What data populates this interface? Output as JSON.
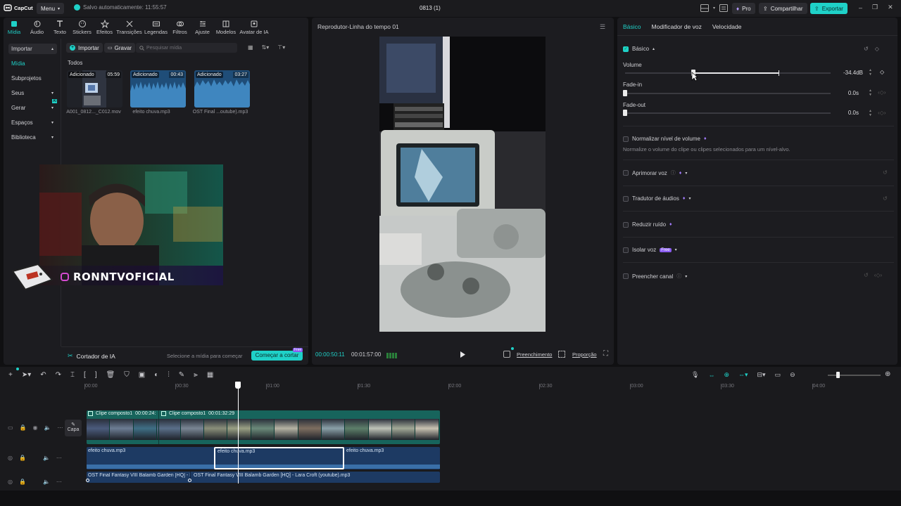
{
  "app": {
    "logo": "CapCut",
    "menu": "Menu",
    "autosave": "Salvo automaticamente: 11:55:57",
    "project_title": "0813 (1)",
    "pro": "Pro",
    "share": "Compartilhar",
    "export": "Exportar"
  },
  "toolbar_tabs": [
    {
      "label": "Mídia",
      "icon": "media-icon"
    },
    {
      "label": "Áudio",
      "icon": "audio-icon"
    },
    {
      "label": "Texto",
      "icon": "text-icon"
    },
    {
      "label": "Stickers",
      "icon": "sticker-icon"
    },
    {
      "label": "Efeitos",
      "icon": "effects-icon"
    },
    {
      "label": "Transições",
      "icon": "transitions-icon"
    },
    {
      "label": "Legendas",
      "icon": "captions-icon"
    },
    {
      "label": "Filtros",
      "icon": "filters-icon"
    },
    {
      "label": "Ajuste",
      "icon": "adjust-icon"
    },
    {
      "label": "Modelos",
      "icon": "templates-icon"
    },
    {
      "label": "Avatar de IA",
      "icon": "ai-avatar-icon"
    }
  ],
  "sidebar": {
    "items": [
      {
        "label": "Importar"
      },
      {
        "label": "Mídia"
      },
      {
        "label": "Subprojetos"
      },
      {
        "label": "Seus"
      },
      {
        "label": "Gerar"
      },
      {
        "label": "Espaços"
      },
      {
        "label": "Biblioteca"
      }
    ]
  },
  "media": {
    "import": "Importar",
    "record": "Gravar",
    "search_placeholder": "Pesquisar mídia",
    "section": "Todos",
    "items": [
      {
        "tag": "Adicionado",
        "duration": "05:59",
        "name": "A001_0812..._C012.mov"
      },
      {
        "tag": "Adicionado",
        "duration": "00:43",
        "name": "efeito chuva.mp3"
      },
      {
        "tag": "Adicionado",
        "duration": "03:27",
        "name": "OST Final ...outube).mp3"
      }
    ],
    "ai_cutter": "Cortador de IA",
    "ai_hint": "Selecione a mídia para começar",
    "start_cut": "Começar a cortar",
    "free_badge": "Free"
  },
  "overlay": {
    "channel": "RONNTVOFICIAL"
  },
  "player": {
    "title": "Reprodutor-Linha do tempo 01",
    "current_time": "00:00:50:11",
    "total_time": "00:01:57:00",
    "fill_label": "Preenchimento",
    "ratio_label": "Proporção"
  },
  "inspector": {
    "tabs": [
      "Básico",
      "Modificador de voz",
      "Velocidade"
    ],
    "section": "Básico",
    "volume_label": "Volume",
    "volume_value": "-34.4dB",
    "fadein_label": "Fade-in",
    "fadein_value": "0.0s",
    "fadeout_label": "Fade-out",
    "fadeout_value": "0.0s",
    "normalize_label": "Normalizar nível de volume",
    "normalize_desc": "Normalize o volume do clipe ou clipes selecionados para um nível-alvo.",
    "enhance_voice": "Aprimorar voz",
    "audio_translator": "Tradutor de áudios",
    "reduce_noise": "Reduzir ruído",
    "isolate_voice": "Isolar voz",
    "isolate_badge": "Free",
    "fill_channel": "Preencher canal"
  },
  "timeline": {
    "ruler": [
      "00:00",
      "00:30",
      "01:00",
      "01:30",
      "02:00",
      "02:30",
      "03:00",
      "03:30",
      "04:00"
    ],
    "cover_label": "Capa",
    "clip1": "Clipe composto1",
    "clip1_time": "00:00:24:",
    "clip2": "Clipe composto1",
    "clip2_time": "00:01:32:29",
    "audio_clips": [
      "efeito chuva.mp3",
      "efeito chuva.mp3",
      "efeito chuva.mp3"
    ],
    "music_clips": [
      "OST Final Fantasy VIII Balamb Garden [HQ] - Lar",
      "OST Final Fantasy VIII Balamb Garden [HQ] - Lara Croft (youtube).mp3"
    ]
  },
  "colors": {
    "accent": "#1fd1c8",
    "bg": "#101012",
    "panel": "#1c1c20",
    "audio_clip": "#1d3a63",
    "video_clip": "#17645c",
    "export": "#1fd1c8"
  }
}
